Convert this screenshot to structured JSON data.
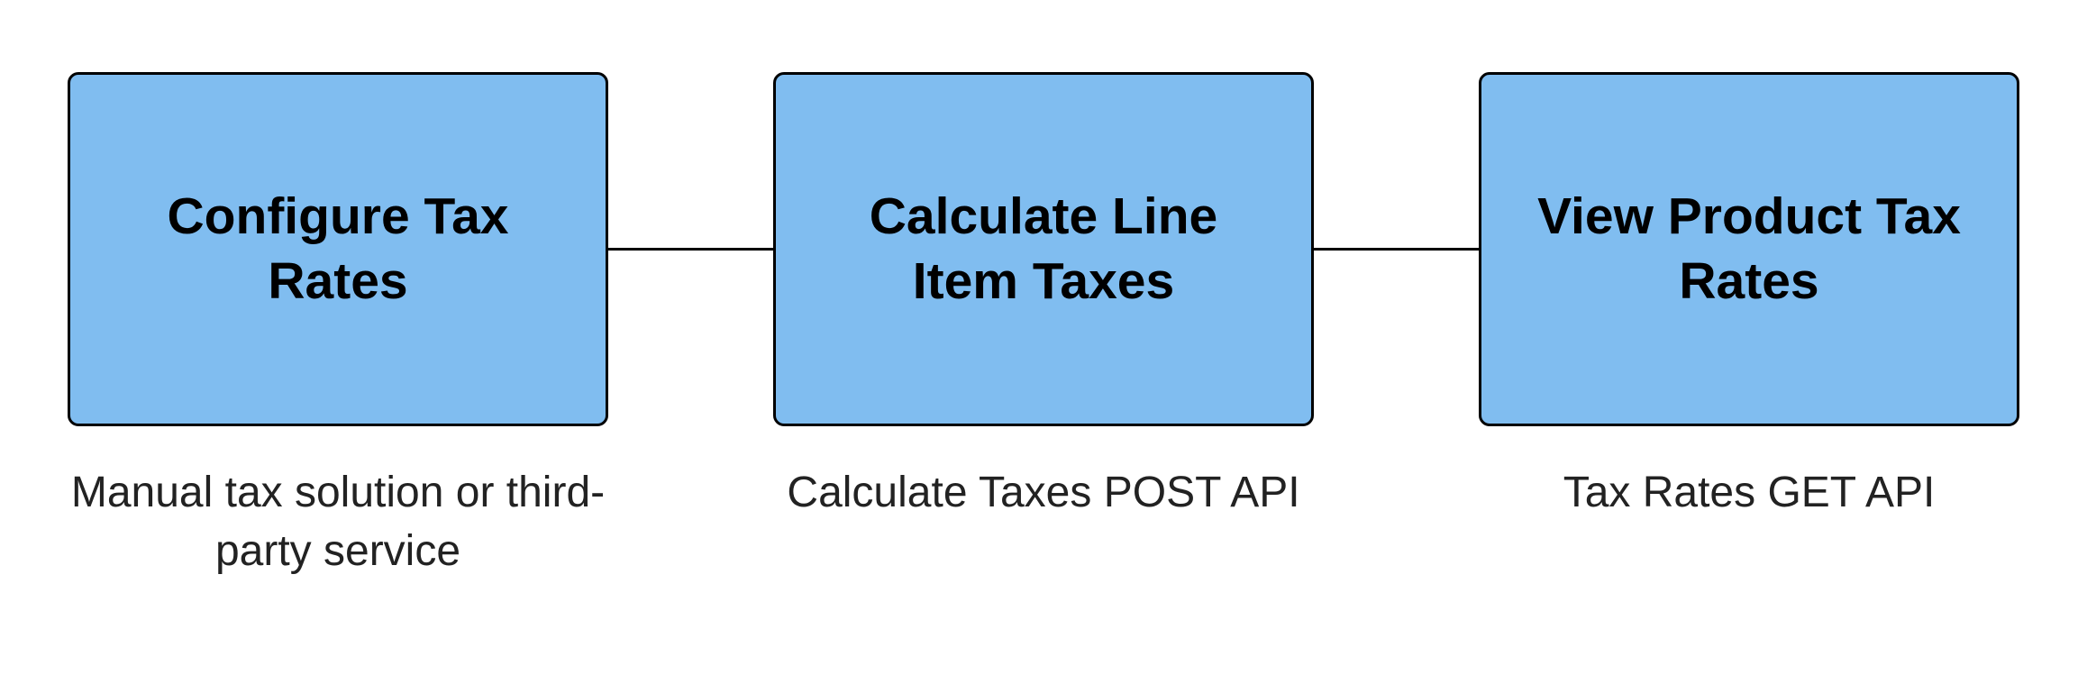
{
  "diagram": {
    "steps": [
      {
        "title": "Configure Tax Rates",
        "caption": "Manual tax solution or third-party service"
      },
      {
        "title": "Calculate Line Item Taxes",
        "caption": "Calculate Taxes POST API"
      },
      {
        "title": "View Product Tax Rates",
        "caption": "Tax Rates GET API"
      }
    ],
    "box_color": "#80bdf0"
  }
}
